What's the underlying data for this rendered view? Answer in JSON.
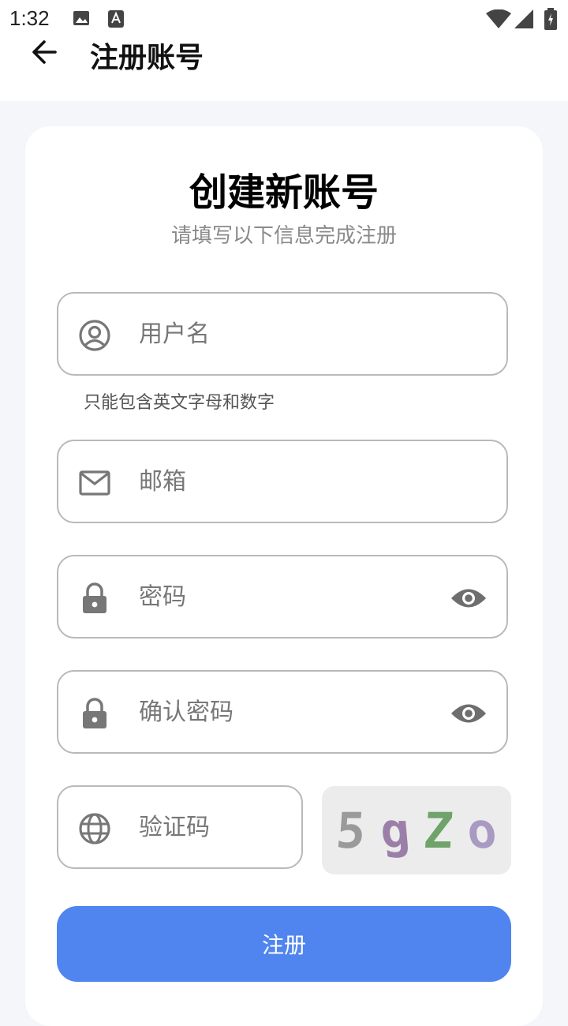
{
  "status_bar": {
    "time": "1:32"
  },
  "header": {
    "title": "注册账号"
  },
  "form": {
    "title": "创建新账号",
    "subtitle": "请填写以下信息完成注册",
    "username": {
      "placeholder": "用户名",
      "hint": "只能包含英文字母和数字"
    },
    "email": {
      "placeholder": "邮箱"
    },
    "password": {
      "placeholder": "密码"
    },
    "confirm_password": {
      "placeholder": "确认密码"
    },
    "captcha": {
      "placeholder": "验证码",
      "chars": [
        "5",
        "g",
        "Z",
        "o"
      ],
      "char_colors": [
        "#9a9a9a",
        "#9b7fa8",
        "#6ea36a",
        "#a89ac2"
      ]
    },
    "submit_label": "注册"
  },
  "colors": {
    "primary": "#5085ef",
    "background": "#f5f6fa",
    "card": "#ffffff"
  }
}
